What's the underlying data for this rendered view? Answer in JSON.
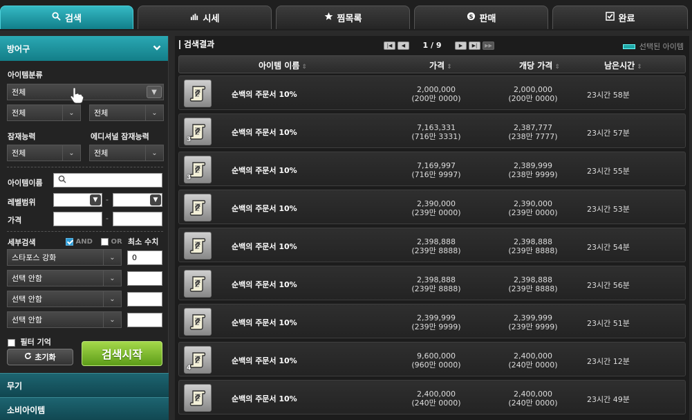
{
  "tabs": [
    {
      "label": "검색",
      "icon": "search-icon",
      "active": true
    },
    {
      "label": "시세",
      "icon": "bar-chart-icon",
      "active": false
    },
    {
      "label": "찜목록",
      "icon": "star-icon",
      "active": false
    },
    {
      "label": "판매",
      "icon": "coin-s-icon",
      "active": false
    },
    {
      "label": "완료",
      "icon": "check-box-icon",
      "active": false
    }
  ],
  "filters": {
    "category_title": "방어구",
    "item_class_label": "아이템분류",
    "item_class_value": "전체",
    "sub_class_1": "전체",
    "sub_class_2": "전체",
    "potential_label": "잠재능력",
    "potential_value": "전체",
    "additional_potential_label": "에디셔널 잠재능력",
    "additional_potential_value": "전체",
    "item_name_label": "아이템이름",
    "item_name_value": "",
    "level_range_label": "레벨범위",
    "price_label": "가격",
    "range_dash": "-",
    "detail_search_label": "세부검색",
    "and_label": "AND",
    "or_label": "OR",
    "min_value_label": "최소 수치",
    "detail_rows": [
      {
        "option": "스타포스 강화",
        "value": "0"
      },
      {
        "option": "선택 안함",
        "value": ""
      },
      {
        "option": "선택 안함",
        "value": ""
      },
      {
        "option": "선택 안함",
        "value": ""
      }
    ],
    "remember_filter_label": "필터 기억",
    "reset_label": "초기화",
    "search_button_label": "검색시작"
  },
  "categories_below": [
    "무기",
    "소비아이템"
  ],
  "results": {
    "title": "검색결과",
    "page_info": "1 / 9",
    "legend_label": "선택된 아이템",
    "columns": {
      "name": "아이템 이름",
      "price": "가격",
      "unit_price": "개당 가격",
      "remaining": "남은시간"
    },
    "rows": [
      {
        "name": "순백의 주문서 10%",
        "price": "2,000,000",
        "price_sub": "(200만 0000)",
        "unit": "2,000,000",
        "unit_sub": "(200만 0000)",
        "time": "23시간 58분",
        "qty": ""
      },
      {
        "name": "순백의 주문서 10%",
        "price": "7,163,331",
        "price_sub": "(716만 3331)",
        "unit": "2,387,777",
        "unit_sub": "(238만 7777)",
        "time": "23시간 57분",
        "qty": "3"
      },
      {
        "name": "순백의 주문서 10%",
        "price": "7,169,997",
        "price_sub": "(716만 9997)",
        "unit": "2,389,999",
        "unit_sub": "(238만 9999)",
        "time": "23시간 55분",
        "qty": "3"
      },
      {
        "name": "순백의 주문서 10%",
        "price": "2,390,000",
        "price_sub": "(239만 0000)",
        "unit": "2,390,000",
        "unit_sub": "(239만 0000)",
        "time": "23시간 53분",
        "qty": ""
      },
      {
        "name": "순백의 주문서 10%",
        "price": "2,398,888",
        "price_sub": "(239만 8888)",
        "unit": "2,398,888",
        "unit_sub": "(239만 8888)",
        "time": "23시간 54분",
        "qty": ""
      },
      {
        "name": "순백의 주문서 10%",
        "price": "2,398,888",
        "price_sub": "(239만 8888)",
        "unit": "2,398,888",
        "unit_sub": "(239만 8888)",
        "time": "23시간 56분",
        "qty": ""
      },
      {
        "name": "순백의 주문서 10%",
        "price": "2,399,999",
        "price_sub": "(239만 9999)",
        "unit": "2,399,999",
        "unit_sub": "(239만 9999)",
        "time": "23시간 51분",
        "qty": ""
      },
      {
        "name": "순백의 주문서 10%",
        "price": "9,600,000",
        "price_sub": "(960만 0000)",
        "unit": "2,400,000",
        "unit_sub": "(240만 0000)",
        "time": "23시간 12분",
        "qty": "4"
      },
      {
        "name": "순백의 주문서 10%",
        "price": "2,400,000",
        "price_sub": "(240만 0000)",
        "unit": "2,400,000",
        "unit_sub": "(240만 0000)",
        "time": "23시간 49분",
        "qty": ""
      }
    ]
  }
}
